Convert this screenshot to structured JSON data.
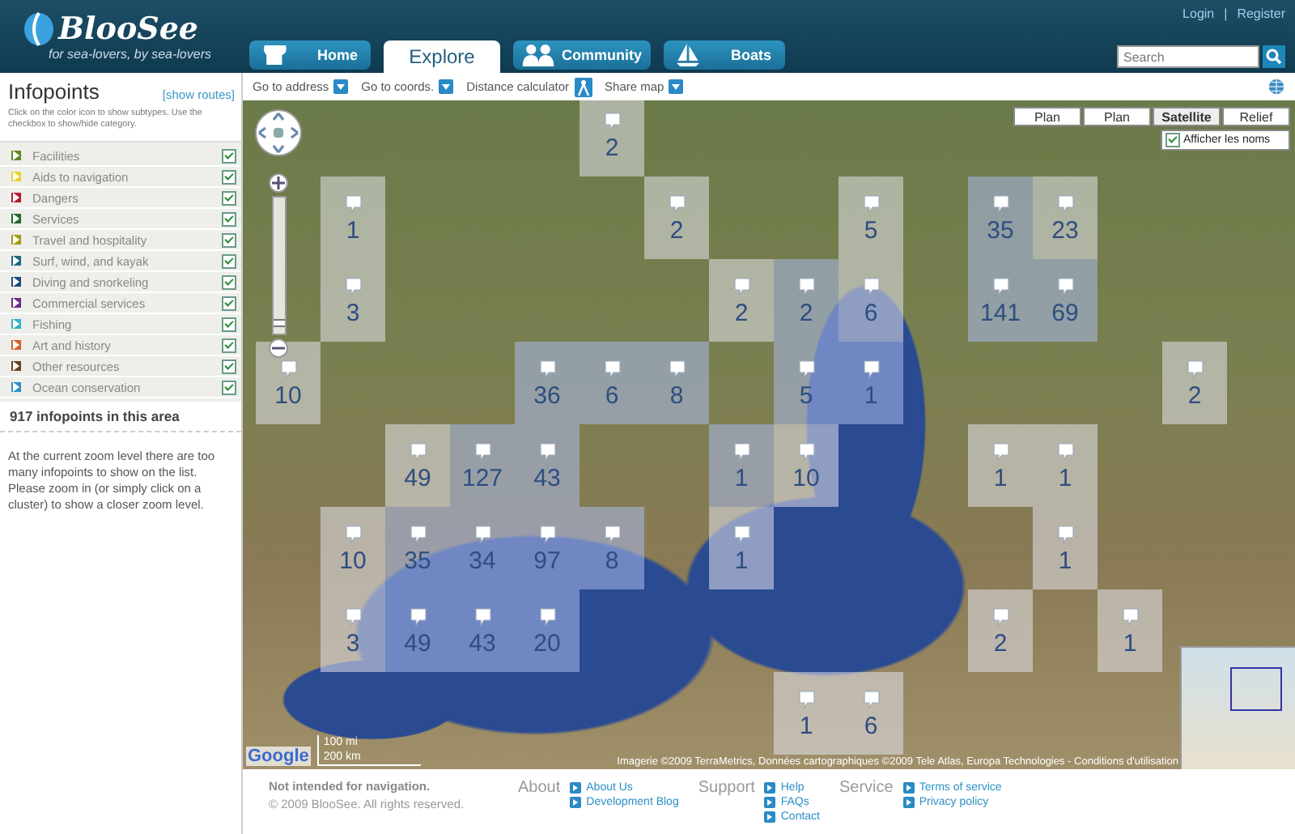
{
  "header": {
    "logo": "BlooSee",
    "tagline": "for sea-lovers, by sea-lovers",
    "account_links": [
      "Login",
      "|",
      "Register"
    ],
    "search": {
      "placeholder": "Search"
    }
  },
  "nav_tabs": [
    {
      "label": "Home",
      "selected": false
    },
    {
      "label": "Explore",
      "selected": true
    },
    {
      "label": "Community",
      "selected": false
    },
    {
      "label": "Boats",
      "selected": false
    }
  ],
  "sidebar": {
    "title": "Infopoints",
    "routes_link": "[show routes]",
    "hint": "Click on the color icon to show subtypes. Use the checkbox to show/hide category.",
    "categories": [
      {
        "label": "Facilities",
        "color": "#5e8a22",
        "checked": true
      },
      {
        "label": "Aids to navigation",
        "color": "#e6d22e",
        "checked": true
      },
      {
        "label": "Dangers",
        "color": "#b01e32",
        "checked": true
      },
      {
        "label": "Services",
        "color": "#23692e",
        "checked": true
      },
      {
        "label": "Travel and hospitality",
        "color": "#a39a12",
        "checked": true
      },
      {
        "label": "Surf, wind, and kayak",
        "color": "#1c6b7c",
        "checked": true
      },
      {
        "label": "Diving and snorkeling",
        "color": "#1b4b7d",
        "checked": true
      },
      {
        "label": "Commercial services",
        "color": "#6b2a8c",
        "checked": true
      },
      {
        "label": "Fishing",
        "color": "#34b4c4",
        "checked": true
      },
      {
        "label": "Art and history",
        "color": "#d2622a",
        "checked": true
      },
      {
        "label": "Other resources",
        "color": "#6a4222",
        "checked": true
      },
      {
        "label": "Ocean conservation",
        "color": "#2f90c4",
        "checked": true
      }
    ],
    "count": "917 infopoints in this area",
    "message": "At the current zoom level there are too many infopoints to show on the list. Please zoom in (or simply click on a cluster) to show a closer zoom level."
  },
  "toolbar": [
    {
      "label": "Go to address",
      "kind": "dropdown"
    },
    {
      "label": "Go to coords.",
      "kind": "dropdown"
    },
    {
      "label": "Distance calculator",
      "kind": "tool"
    },
    {
      "label": "Share map",
      "kind": "dropdown"
    }
  ],
  "map": {
    "map_types": [
      {
        "label": "Plan",
        "selected": false
      },
      {
        "label": "Plan",
        "selected": false
      },
      {
        "label": "Satellite",
        "selected": true
      },
      {
        "label": "Relief",
        "selected": false
      }
    ],
    "show_names": {
      "label": "Afficher les noms",
      "checked": true
    },
    "zoom": {
      "level": 0.05
    },
    "scale": [
      "100 mi",
      "200 km"
    ],
    "logo": "Google",
    "attribution": "Imagerie ©2009 TerraMetrics, Données cartographiques ©2009 Tele Atlas, Europa Technologies - Conditions d'utilisation",
    "clusters": [
      {
        "count": "2"
      },
      {
        "count": "1"
      },
      {
        "count": "2"
      },
      {
        "count": "5"
      },
      {
        "count": "35"
      },
      {
        "count": "23"
      },
      {
        "count": "3"
      },
      {
        "count": "2"
      },
      {
        "count": "2"
      },
      {
        "count": "6"
      },
      {
        "count": "141"
      },
      {
        "count": "69"
      },
      {
        "count": "10"
      },
      {
        "count": "36"
      },
      {
        "count": "6"
      },
      {
        "count": "8"
      },
      {
        "count": "5"
      },
      {
        "count": "1"
      },
      {
        "count": "2"
      },
      {
        "count": "49"
      },
      {
        "count": "127"
      },
      {
        "count": "43"
      },
      {
        "count": "1"
      },
      {
        "count": "10"
      },
      {
        "count": "1"
      },
      {
        "count": "1"
      },
      {
        "count": "10"
      },
      {
        "count": "35"
      },
      {
        "count": "34"
      },
      {
        "count": "97"
      },
      {
        "count": "8"
      },
      {
        "count": "1"
      },
      {
        "count": "1"
      },
      {
        "count": "3"
      },
      {
        "count": "49"
      },
      {
        "count": "43"
      },
      {
        "count": "20"
      },
      {
        "count": "2"
      },
      {
        "count": "1"
      },
      {
        "count": "1"
      },
      {
        "count": "6"
      }
    ]
  },
  "footer": {
    "notice": "Not intended for navigation.",
    "copyright": "© 2009 BlooSee. All rights reserved.",
    "groups": [
      {
        "title": "About",
        "links": [
          "About Us",
          "Development Blog"
        ]
      },
      {
        "title": "Support",
        "links": [
          "Help",
          "FAQs",
          "Contact"
        ]
      },
      {
        "title": "Service",
        "links": [
          "Terms of service",
          "Privacy policy"
        ]
      }
    ]
  }
}
